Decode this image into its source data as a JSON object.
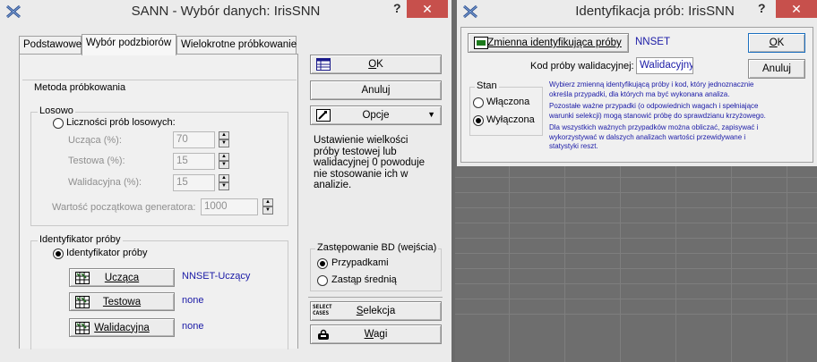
{
  "left_window": {
    "title": "SANN - Wybór danych: IrisSNN",
    "help": "?",
    "close": "✕",
    "tabs": [
      "Podstawowe",
      "Wybór podzbiorów",
      "Wielokrotne próbkowanie"
    ],
    "method_group": "Metoda próbkowania",
    "random_group": "Losowo",
    "random_radio": "Liczności prób losowych:",
    "fields": [
      {
        "label": "Ucząca (%):",
        "value": "70"
      },
      {
        "label": "Testowa (%):",
        "value": "15"
      },
      {
        "label": "Walidacyjna (%):",
        "value": "15"
      }
    ],
    "seed_label": "Wartość początkowa generatora:",
    "seed_value": "1000",
    "id_group": "Identyfikator próby",
    "id_radio": "Identyfikator próby",
    "id_buttons": [
      {
        "label": "Ucząca",
        "value": "NNSET-Uczący"
      },
      {
        "label": "Testowa",
        "value": "none"
      },
      {
        "label": "Walidacyjna",
        "value": "none"
      }
    ],
    "ok": "OK",
    "cancel": "Anuluj",
    "options": "Opcje",
    "info": [
      "Ustawienie wielkości",
      "próby testowej lub",
      "walidacyjnej 0 powoduje",
      "nie stosowanie ich w",
      "analizie."
    ],
    "replace_group": "Zastępowanie BD (wejścia)",
    "replace_options": [
      "Przypadkami",
      "Zastąp średnią"
    ],
    "select_cases_icon": "SELECT\nCASES",
    "select_cases_icon_l1": "SELECT",
    "select_cases_icon_l2": "CASES",
    "selection": "Selekcja",
    "weights": "Wagi"
  },
  "right_window": {
    "title": "Identyfikacja prób: IrisSNN",
    "help": "?",
    "close": "✕",
    "var_button": "Zmienna identyfikująca próby",
    "var_value": "NNSET",
    "ok": "OK",
    "cancel": "Anuluj",
    "code_label": "Kod próby walidacyjnej:",
    "code_value": "Walidacyjny",
    "state_group": "Stan",
    "state_options": [
      "Włączona",
      "Wyłączona"
    ],
    "help_lines": [
      "Wybierz zmienną identyfikującą próby i kod, który jednoznacznie",
      "określa przypadki, dla których ma być wykonana analiza.",
      "Pozostałe ważne przypadki (o odpowiednich wagach  i spełniające",
      "warunki selekcji) mogą stanowić próbę do sprawdzianu krzyżowego.",
      "Dla wszystkich ważnych przypadków można obliczać, zapisywać i",
      "wykorzystywać w dalszych analizach  wartości przewidywane i",
      "statystyki reszt."
    ]
  },
  "colors": {
    "background": "#6a6a6a",
    "spreadsheet_grid": "#7e7e7e",
    "close_button": "#c7504c",
    "link_blue": "#1a1aa6"
  }
}
